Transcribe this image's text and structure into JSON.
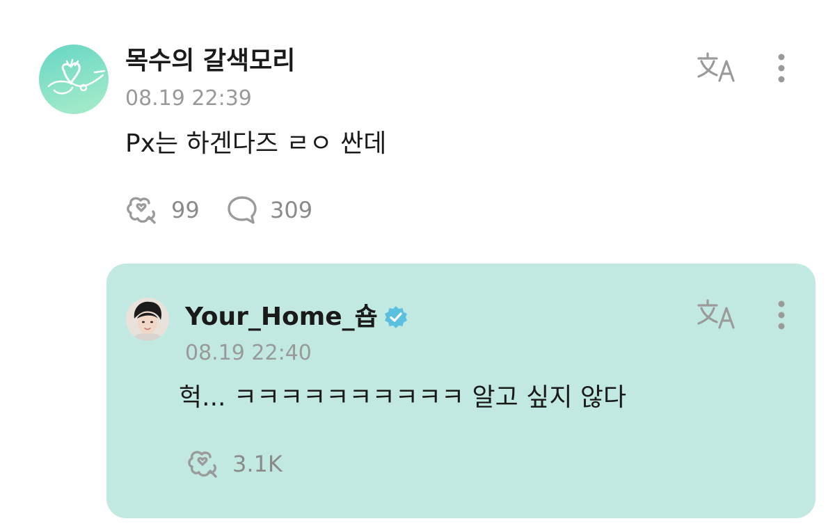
{
  "post": {
    "author": "목수의 갈색모리",
    "timestamp": "08.19 22:39",
    "text": "Px는 하겐다즈 ㄹㅇ 싼데",
    "likes_count": "99",
    "comments_count": "309",
    "icons": {
      "like": "heart-bubble-icon",
      "comment": "speech-bubble-icon",
      "translate": "translate-icon",
      "more": "more-vertical-icon"
    }
  },
  "reply": {
    "author": "Your_Home_숍",
    "verified": true,
    "timestamp": "08.19 22:40",
    "text": "헉... ㅋㅋㅋㅋㅋㅋㅋㅋㅋㅋ 알고 싶지 않다",
    "likes_count": "3.1K",
    "background_color": "#c1e9e1",
    "icons": {
      "like": "heart-bubble-icon",
      "translate": "translate-icon",
      "more": "more-vertical-icon",
      "verified": "verified-badge-icon"
    }
  },
  "colors": {
    "text_primary": "#1a1a1a",
    "text_secondary": "#999999",
    "icon_gray": "#9a9a9a",
    "verified_blue": "#5bc0e0",
    "avatar_mint_top": "#6fd9c6",
    "avatar_mint_bottom": "#a8ecd8"
  }
}
